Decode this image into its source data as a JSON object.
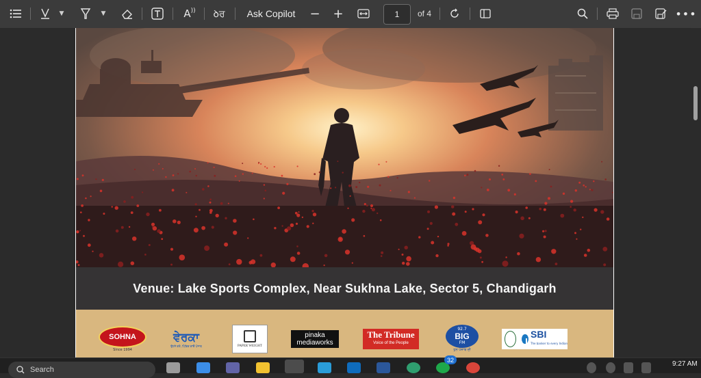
{
  "toolbar": {
    "ask_copilot": "Ask Copilot",
    "page_current": "1",
    "page_total": "of 4",
    "icons": [
      "contents-icon",
      "draw-icon",
      "chevron-down-icon",
      "highlight-icon",
      "chevron-down-icon",
      "eraser-icon",
      "text-box-icon",
      "read-aloud-icon",
      "translate-icon",
      "zoom-out-icon",
      "zoom-in-icon",
      "fit-width-icon",
      "rotate-icon",
      "page-view-icon",
      "search-icon",
      "print-icon",
      "save-icon",
      "save-as-icon",
      "more-icon"
    ],
    "translate_glyph": "ꝺਰ"
  },
  "document": {
    "venue": "Venue: Lake Sports Complex, Near Sukhna Lake, Sector 5, Chandigarh",
    "sponsors": {
      "sohna": {
        "name": "SOHNA",
        "tag": "Since 1994"
      },
      "verka": {
        "name": "ਵੇਰਕਾ",
        "tag": "ਉਹਨੇ ਕਰੋ, ਪਿੰਡਿਕ ਕਾਂਓ ਪੰਜਾਬ"
      },
      "paper_weight": {
        "name": "PAPER WEIGHT"
      },
      "pinaka": {
        "line1": "pinaka",
        "line2": "mediaworks"
      },
      "tribune": {
        "name": "The Tribune",
        "tag": "Voice of the People"
      },
      "bigfm": {
        "freq": "92.7",
        "name": "BIG",
        "sub": "FM",
        "tag": "ਧੁਨ ਪੰਜਾਬ ਦੀ"
      },
      "sbi": {
        "name": "SBI",
        "tag": "The banker to every Indian"
      }
    }
  },
  "taskbar": {
    "search": "Search",
    "badge": "32",
    "time": "9:27 AM"
  },
  "colors": {
    "toolbar": "#3b3b3b",
    "venue_bg": "#353334",
    "sponsor_bg": "#d9b77f",
    "sky_top": "#6e5546",
    "sky_glow": "#f6d79a",
    "field": "#3a1f1c"
  }
}
